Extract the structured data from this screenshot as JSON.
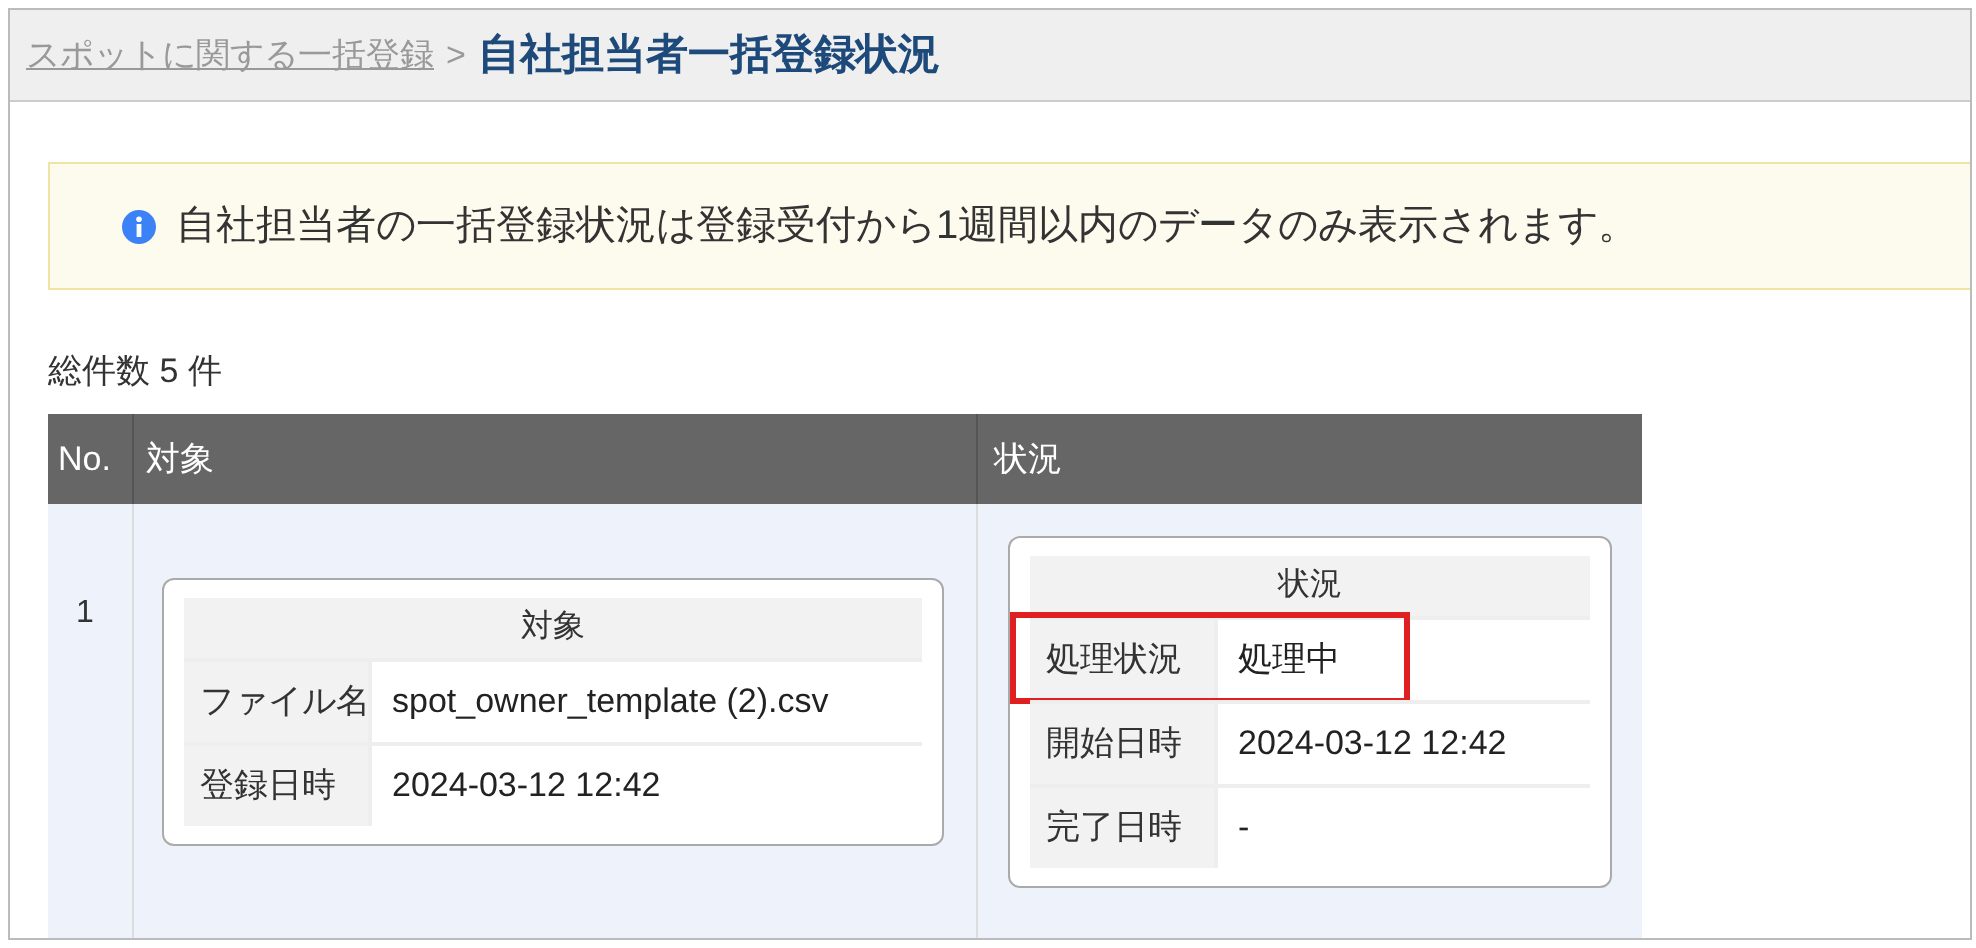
{
  "breadcrumb": {
    "parent": "スポットに関する一括登録",
    "separator": ">",
    "current": "自社担当者一括登録状況"
  },
  "notice": "自社担当者の一括登録状況は登録受付から1週間以内のデータのみ表示されます。",
  "total": "総件数 5 件",
  "table": {
    "columns": [
      "No.",
      "対象",
      "状況"
    ],
    "rows": [
      {
        "no": "1",
        "target": {
          "title": "対象",
          "fields": [
            {
              "label": "ファイル名",
              "value": "spot_owner_template (2).csv",
              "highlighted": false
            },
            {
              "label": "登録日時",
              "value": "2024-03-12 12:42",
              "highlighted": false
            }
          ]
        },
        "status": {
          "title": "状況",
          "fields": [
            {
              "label": "処理状況",
              "value": "処理中",
              "highlighted": true
            },
            {
              "label": "開始日時",
              "value": "2024-03-12 12:42",
              "highlighted": false
            },
            {
              "label": "完了日時",
              "value": "-",
              "highlighted": false
            }
          ]
        }
      }
    ]
  }
}
